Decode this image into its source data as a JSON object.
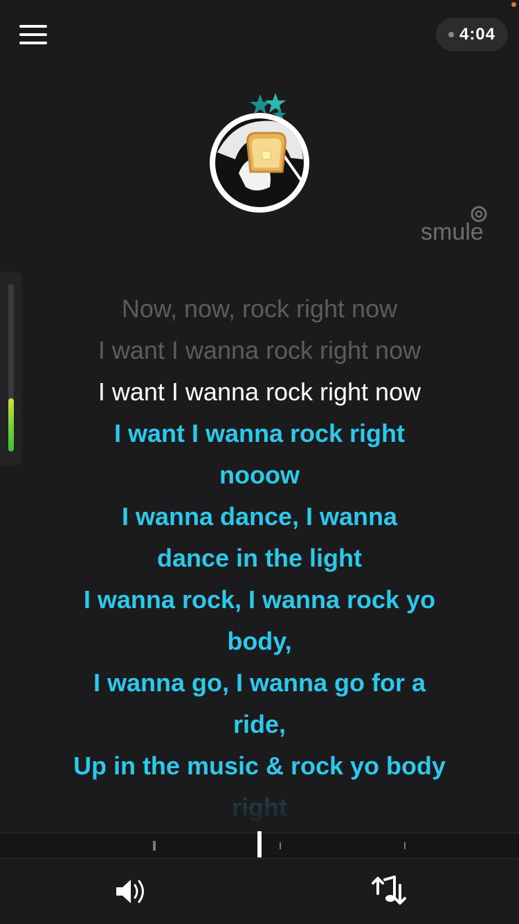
{
  "header": {
    "timer": "4:04"
  },
  "brand": {
    "wordmark": "smule"
  },
  "lyrics": {
    "past": [
      "Now, now, rock right now",
      "I want I wanna rock right now"
    ],
    "current": "I want I wanna rock right now",
    "upcoming": [
      "I want I wanna rock right",
      "nooow",
      "I wanna dance, I wanna",
      "dance in the light",
      "I wanna rock, I wanna rock yo",
      "body,",
      "I wanna go, I wanna go for a",
      "ride,",
      "Up in the music & rock yo body"
    ],
    "fading": "right"
  },
  "meter": {
    "level": 0.32
  },
  "icons": {
    "menu": "hamburger-menu-icon",
    "volume": "volume-icon",
    "pitch": "pitch-adjust-icon",
    "stars": "star-icon"
  },
  "colors": {
    "background": "#1b1b1d",
    "accent": "#2ec8ea",
    "past_lyric": "#5c5c5e",
    "meter": "#35c13a"
  }
}
